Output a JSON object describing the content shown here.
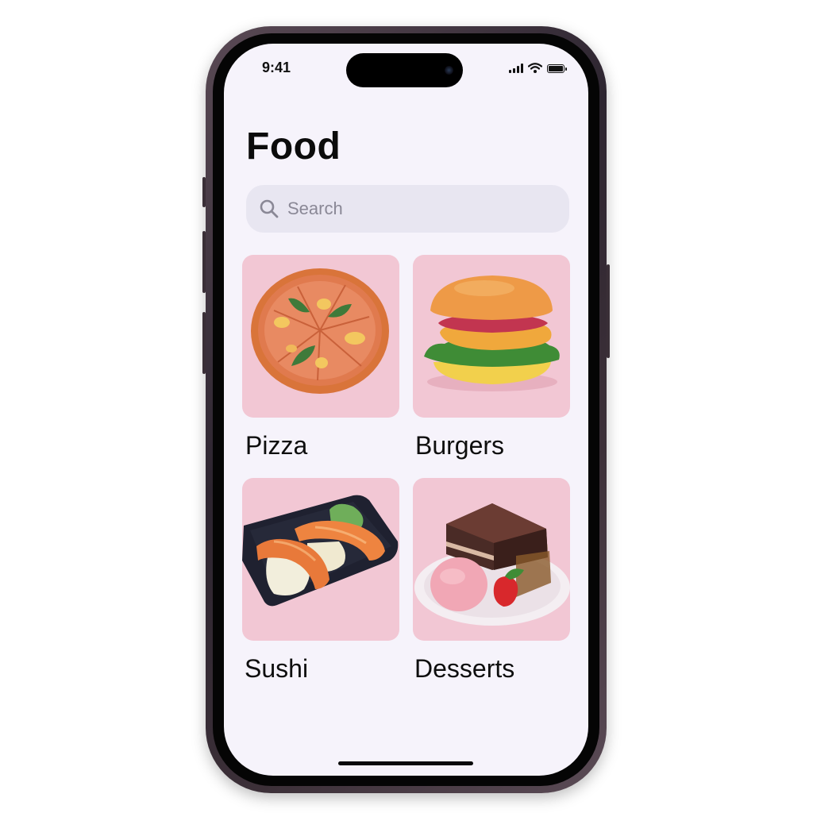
{
  "status_bar": {
    "time": "9:41",
    "icons": [
      "cellular-signal-icon",
      "wifi-icon",
      "battery-icon"
    ]
  },
  "header": {
    "title": "Food"
  },
  "search": {
    "placeholder": "Search",
    "icon": "search-icon"
  },
  "categories": [
    {
      "label": "Pizza",
      "image": "pizza-image"
    },
    {
      "label": "Burgers",
      "image": "burger-image"
    },
    {
      "label": "Sushi",
      "image": "sushi-image"
    },
    {
      "label": "Desserts",
      "image": "dessert-image"
    }
  ],
  "colors": {
    "screen_background": "#f6f3fb",
    "tile_background": "#f2c7d4",
    "search_background": "#e8e6f1",
    "text": "#0b0b0b"
  }
}
